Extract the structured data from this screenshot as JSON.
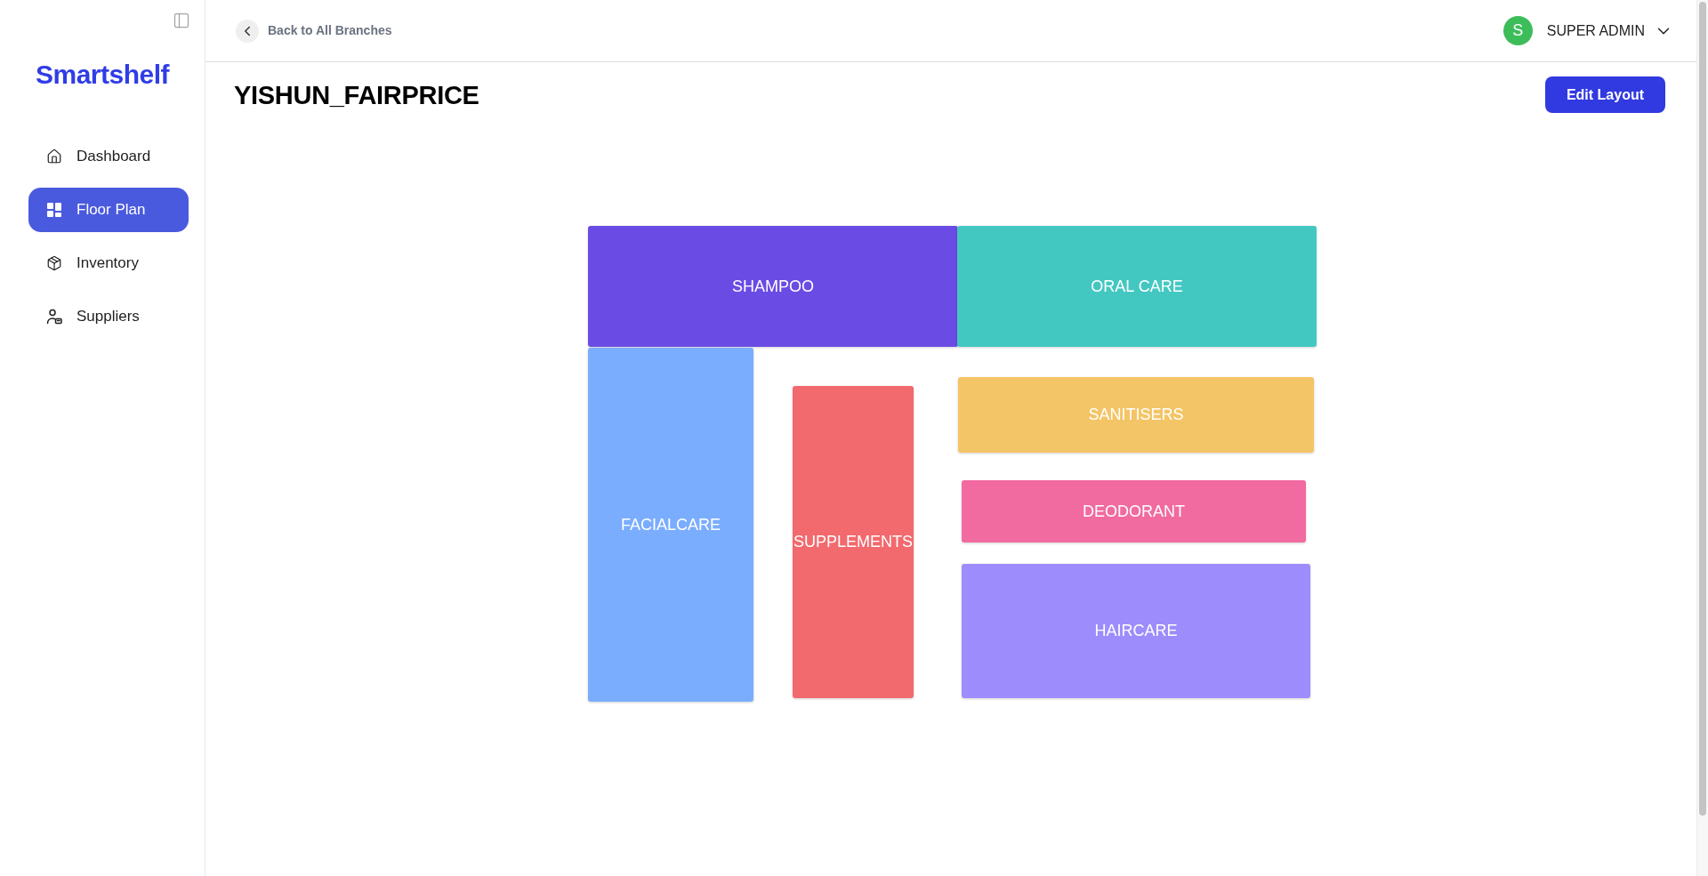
{
  "sidebar": {
    "logo": "Smartshelf",
    "items": [
      {
        "label": "Dashboard",
        "selected": false
      },
      {
        "label": "Floor Plan",
        "selected": true
      },
      {
        "label": "Inventory",
        "selected": false
      },
      {
        "label": "Suppliers",
        "selected": false
      }
    ]
  },
  "header": {
    "back_link": "Back to All Branches",
    "user": {
      "avatar_initial": "S",
      "name": "SUPER ADMIN"
    }
  },
  "page": {
    "title": "YISHUN_FAIRPRICE",
    "edit_button": "Edit Layout"
  },
  "floor_plan": {
    "sections": [
      {
        "label": "SHAMPOO",
        "color": "#6a4be3"
      },
      {
        "label": "ORAL CARE",
        "color": "#43c8c1"
      },
      {
        "label": "FACIALCARE",
        "color": "#7aadfe"
      },
      {
        "label": "SUPPLEMENTS",
        "color": "#f2696e"
      },
      {
        "label": "SANITISERS",
        "color": "#f4c566"
      },
      {
        "label": "DEODORANT",
        "color": "#f16aa0"
      },
      {
        "label": "HAIRCARE",
        "color": "#9d8cfc"
      }
    ]
  }
}
